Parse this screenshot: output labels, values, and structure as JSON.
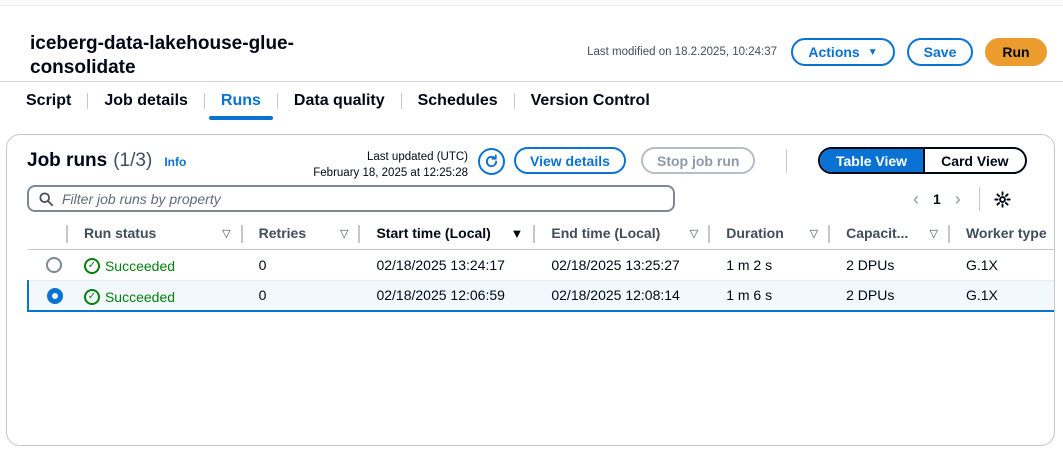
{
  "job": {
    "title": "iceberg-data-lakehouse-glue-consolidate",
    "last_modified": "Last modified on 18.2.2025, 10:24:37",
    "actions_label": "Actions",
    "save_label": "Save",
    "run_label": "Run"
  },
  "tabs": [
    {
      "label": "Script"
    },
    {
      "label": "Job details"
    },
    {
      "label": "Runs",
      "active": true
    },
    {
      "label": "Data quality"
    },
    {
      "label": "Schedules"
    },
    {
      "label": "Version Control"
    }
  ],
  "runs_panel": {
    "title": "Job runs",
    "count": "(1/3)",
    "info_label": "Info",
    "last_updated_label": "Last updated (UTC)",
    "last_updated_value": "February 18, 2025 at 12:25:28",
    "view_details_label": "View details",
    "stop_job_run_label": "Stop job run",
    "table_view_label": "Table View",
    "card_view_label": "Card View",
    "filter_placeholder": "Filter job runs by property",
    "current_page": "1"
  },
  "table": {
    "columns": [
      "Run status",
      "Retries",
      "Start time (Local)",
      "End time (Local)",
      "Duration",
      "Capacit...",
      "Worker type"
    ],
    "rows": [
      {
        "status": "Succeeded",
        "retries": "0",
        "start": "02/18/2025 13:24:17",
        "end": "02/18/2025 13:25:27",
        "duration": "1 m 2 s",
        "capacity": "2 DPUs",
        "worker": "G.1X",
        "selected": false
      },
      {
        "status": "Succeeded",
        "retries": "0",
        "start": "02/18/2025 12:06:59",
        "end": "02/18/2025 12:08:14",
        "duration": "1 m 6 s",
        "capacity": "2 DPUs",
        "worker": "G.1X",
        "selected": true
      }
    ]
  },
  "colors": {
    "accent": "#0972d3",
    "primary_button": "#ec9c2c",
    "success": "#037f0c"
  }
}
